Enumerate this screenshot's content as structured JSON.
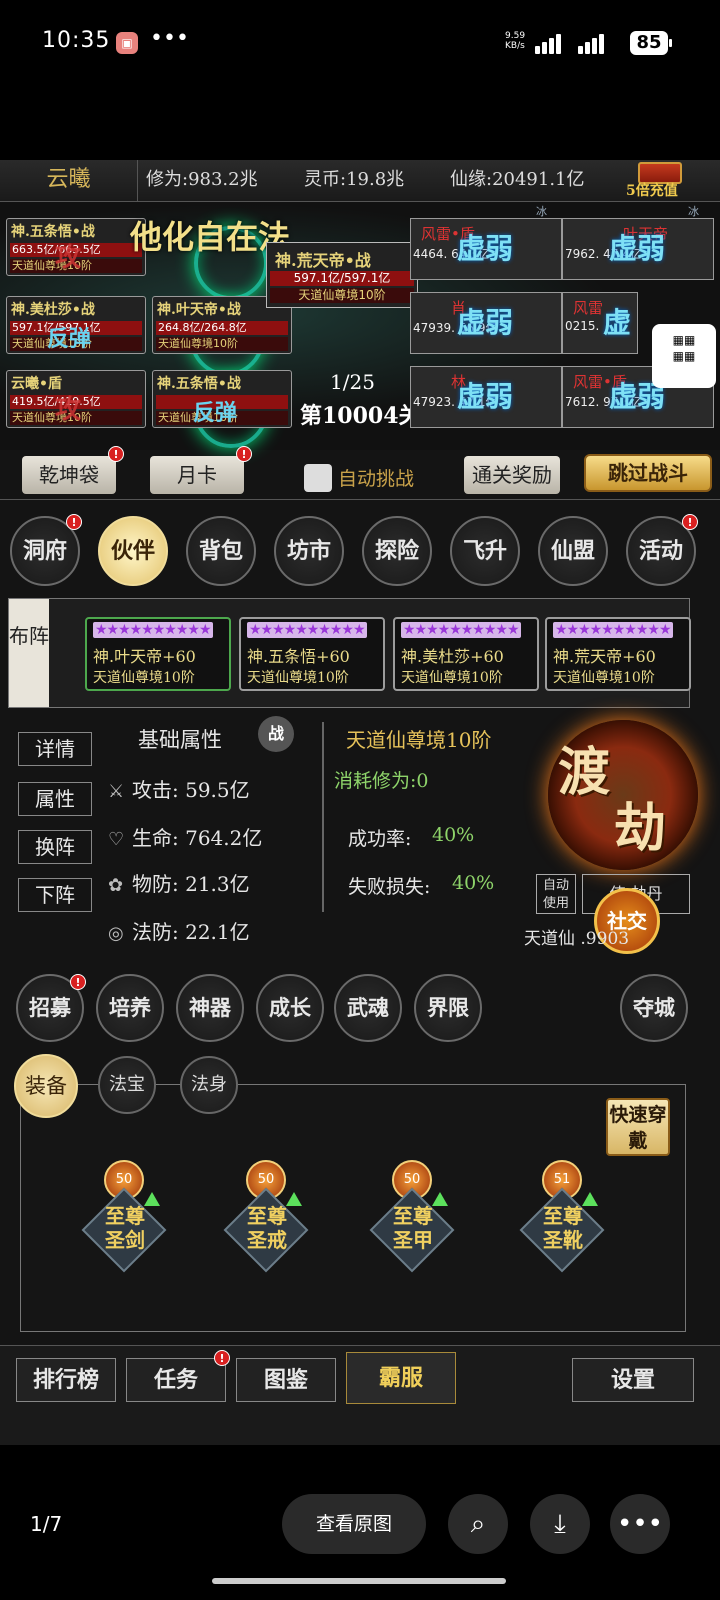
{
  "status_bar": {
    "time": "10:35",
    "notification_icon": "app-icon",
    "more": "•••",
    "net_speed": "9.59 KB/s",
    "signal1_label": "5G",
    "signal2_label": "5G",
    "battery": "85"
  },
  "top_bar": {
    "player_name": "云曦",
    "cultivation": "修为:983.2兆",
    "spirit_coin": "灵币:19.8兆",
    "fate": "仙缘:20491.1亿",
    "recharge": "5倍充值"
  },
  "battle": {
    "skill_name": "他化自在法",
    "wave": "1/25",
    "stage": "第10004关",
    "allies": [
      {
        "name": "神.五条悟•战",
        "hp": "663.5亿/663.5亿",
        "rank": "天道仙尊境10阶",
        "overlay": "攻"
      },
      {
        "name": "神.美杜莎•战",
        "hp": "597.1亿/597.1亿",
        "rank": "天道仙尊境10阶",
        "overlay": "反弹"
      },
      {
        "name": "云曦•盾",
        "hp": "419.5亿/419.5亿",
        "rank": "天道仙尊境10阶",
        "overlay": "攻"
      },
      {
        "name": "神.叶天帝•战",
        "hp": "264.8亿/264.8亿",
        "rank": "天道仙尊境10阶",
        "overlay": ""
      },
      {
        "name": "神.五条悟•战",
        "hp": "",
        "rank": "天道仙尊境10阶",
        "overlay": "反弹"
      }
    ],
    "boss": {
      "name": "神.荒天帝•战",
      "hp": "597.1亿/597.1亿",
      "rank": "天道仙尊境10阶"
    },
    "enemies": [
      {
        "name": "风雷•盾",
        "vals": "4464.      64.3亿",
        "status": "虚弱",
        "tag": "冰"
      },
      {
        "name": "叶天帝",
        "vals": "7962.      47.4亿",
        "status": "虚弱",
        "tag": "冰"
      },
      {
        "name": "肖",
        "vals": "47939.     56.9亿",
        "status": "虚弱",
        "tag": ""
      },
      {
        "name": "风雷",
        "vals": "0215.       ",
        "status": "虚",
        "tag": ""
      },
      {
        "name": "林",
        "vals": "47923.     47.1亿",
        "status": "虚弱",
        "tag": ""
      },
      {
        "name": "风雷•盾",
        "vals": "7612.     97.3亿",
        "status": "虚弱",
        "tag": "冰"
      }
    ]
  },
  "actions": {
    "bag": "乾坤袋",
    "month_card": "月卡",
    "auto_challenge": "自动挑战",
    "clear_reward": "通关奖励",
    "skip_battle": "跳过战斗"
  },
  "main_nav": [
    "洞府",
    "伙伴",
    "背包",
    "坊市",
    "探险",
    "飞升",
    "仙盟",
    "活动"
  ],
  "formation": {
    "tab": "布阵",
    "heroes": [
      {
        "name": "神.叶天帝+60",
        "rank": "天道仙尊境10阶"
      },
      {
        "name": "神.五条悟+60",
        "rank": "天道仙尊境10阶"
      },
      {
        "name": "神.美杜莎+60",
        "rank": "天道仙尊境10阶"
      },
      {
        "name": "神.荒天帝+60",
        "rank": "天道仙尊境10阶"
      }
    ]
  },
  "detail": {
    "side_buttons": [
      "详情",
      "属性",
      "换阵",
      "下阵"
    ],
    "attr_title": "基础属性",
    "war_badge": "战",
    "attack": "攻击: 59.5亿",
    "life": "生命: 764.2亿",
    "phys_def": "物防: 21.3亿",
    "magic_def": "法防: 22.1亿",
    "realm": "天道仙尊境10阶",
    "cost": "消耗修为:0",
    "success_label": "成功率:",
    "success_value": "40%",
    "fail_label": "失败损失:",
    "fail_value": "40%",
    "dujie_1": "渡",
    "dujie_2": "劫",
    "auto_use": "自动使用",
    "use_dan": "使   劫丹",
    "social": "社交",
    "realm2": "天道仙     .9903"
  },
  "sub_nav": [
    "招募",
    "培养",
    "神器",
    "成长",
    "武魂",
    "界限"
  ],
  "capture": "夺城",
  "equip_tabs": [
    "装备",
    "法宝",
    "法身"
  ],
  "quick_equip": "快速穿戴",
  "equipment": [
    {
      "level": "50",
      "name": "至尊圣剑"
    },
    {
      "level": "50",
      "name": "至尊圣戒"
    },
    {
      "level": "50",
      "name": "至尊圣甲"
    },
    {
      "level": "51",
      "name": "至尊圣靴"
    }
  ],
  "bottom_bar": [
    "排行榜",
    "任务",
    "图鉴",
    "霸服",
    "设置"
  ],
  "viewer": {
    "pager": "1/7",
    "view_original": "查看原图"
  }
}
